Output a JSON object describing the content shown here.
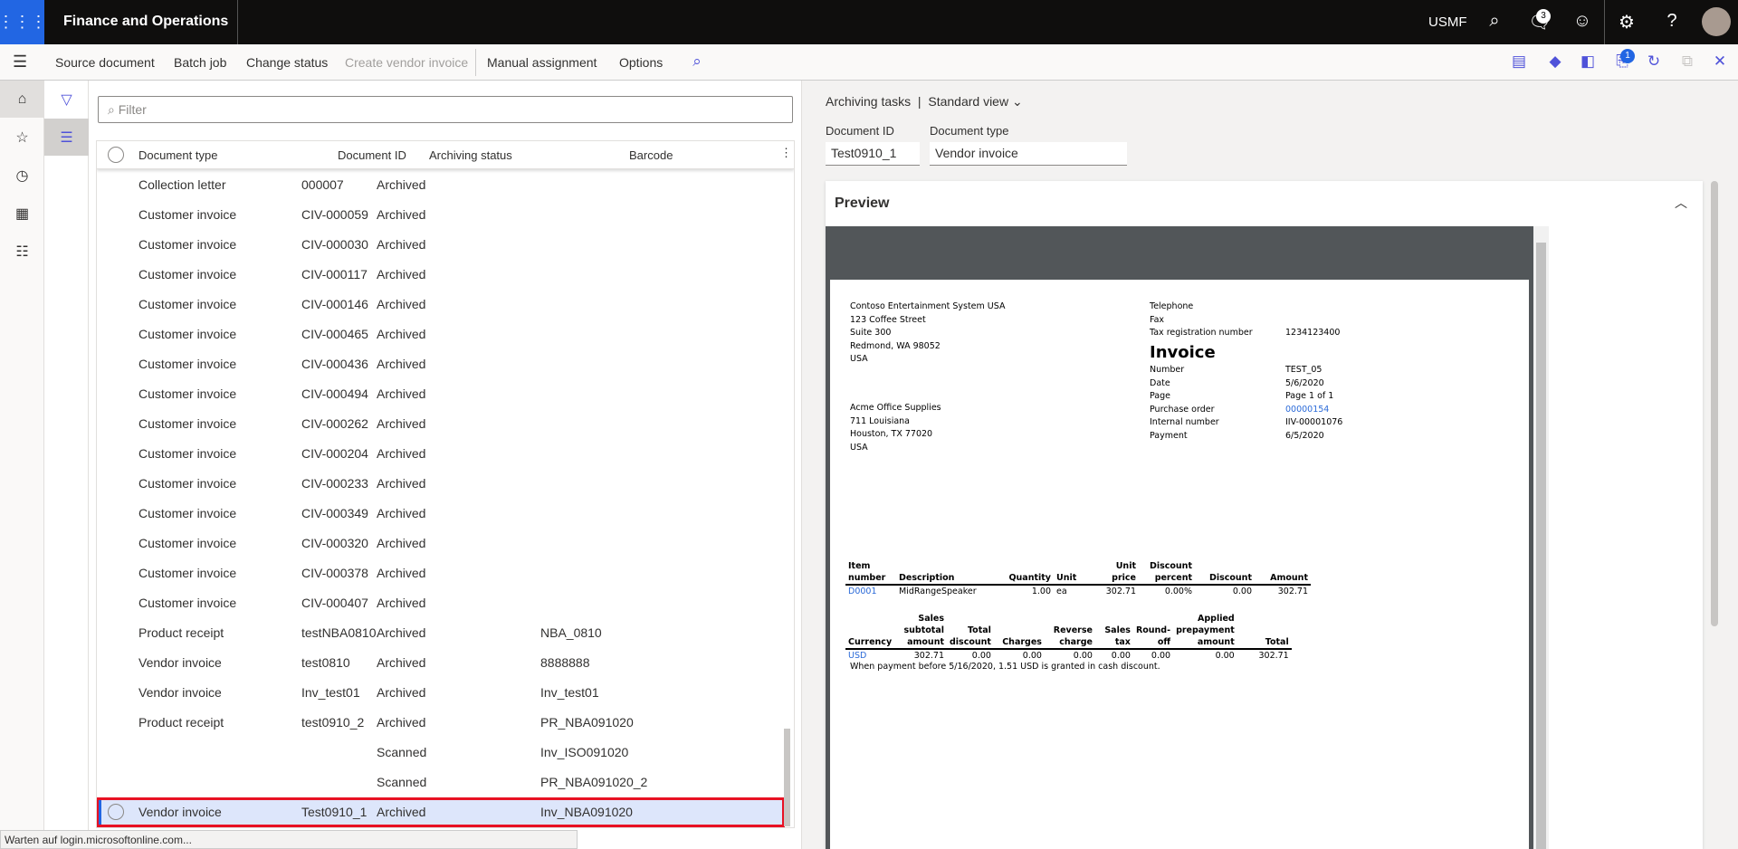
{
  "app": {
    "title": "Finance and Operations",
    "company": "USMF",
    "notifications": "3",
    "status_text": "Warten auf login.microsoftonline.com..."
  },
  "actions": {
    "items": [
      "Source document",
      "Batch job",
      "Change status",
      "Create vendor invoice",
      "Manual assignment",
      "Options"
    ],
    "attachments_count": "1"
  },
  "filter": {
    "placeholder": "Filter"
  },
  "grid": {
    "columns": [
      "Document type",
      "Document ID",
      "Archiving status",
      "Barcode"
    ],
    "rows": [
      [
        "Collection letter",
        "000007",
        "Archived",
        ""
      ],
      [
        "Customer invoice",
        "CIV-000059",
        "Archived",
        ""
      ],
      [
        "Customer invoice",
        "CIV-000030",
        "Archived",
        ""
      ],
      [
        "Customer invoice",
        "CIV-000117",
        "Archived",
        ""
      ],
      [
        "Customer invoice",
        "CIV-000146",
        "Archived",
        ""
      ],
      [
        "Customer invoice",
        "CIV-000465",
        "Archived",
        ""
      ],
      [
        "Customer invoice",
        "CIV-000436",
        "Archived",
        ""
      ],
      [
        "Customer invoice",
        "CIV-000494",
        "Archived",
        ""
      ],
      [
        "Customer invoice",
        "CIV-000262",
        "Archived",
        ""
      ],
      [
        "Customer invoice",
        "CIV-000204",
        "Archived",
        ""
      ],
      [
        "Customer invoice",
        "CIV-000233",
        "Archived",
        ""
      ],
      [
        "Customer invoice",
        "CIV-000349",
        "Archived",
        ""
      ],
      [
        "Customer invoice",
        "CIV-000320",
        "Archived",
        ""
      ],
      [
        "Customer invoice",
        "CIV-000378",
        "Archived",
        ""
      ],
      [
        "Customer invoice",
        "CIV-000407",
        "Archived",
        ""
      ],
      [
        "Product receipt",
        "testNBA0810",
        "Archived",
        "NBA_0810"
      ],
      [
        "Vendor invoice",
        "test0810",
        "Archived",
        "8888888"
      ],
      [
        "Vendor invoice",
        "Inv_test01",
        "Archived",
        "Inv_test01"
      ],
      [
        "Product receipt",
        "test0910_2",
        "Archived",
        "PR_NBA091020"
      ],
      [
        "",
        "",
        "Scanned",
        "Inv_ISO091020"
      ],
      [
        "",
        "",
        "Scanned",
        "PR_NBA091020_2"
      ],
      [
        "Vendor invoice",
        "Test0910_1",
        "Archived",
        "Inv_NBA091020"
      ]
    ],
    "selected_index": 21
  },
  "details": {
    "breadcrumb": "Archiving tasks",
    "view": "Standard view",
    "doc_id_label": "Document ID",
    "doc_id": "Test0910_1",
    "doc_type_label": "Document type",
    "doc_type": "Vendor invoice",
    "preview_label": "Preview"
  },
  "invoice": {
    "from": [
      "Contoso Entertainment System USA",
      "123 Coffee Street",
      "Suite 300",
      "Redmond, WA 98052",
      "USA"
    ],
    "to": [
      "Acme Office Supplies",
      "711 Louisiana",
      "Houston, TX 77020",
      "USA"
    ],
    "contact": [
      [
        "Telephone",
        ""
      ],
      [
        "Fax",
        ""
      ],
      [
        "Tax registration number",
        "1234123400"
      ]
    ],
    "title": "Invoice",
    "meta": [
      [
        "Number",
        "TEST_05"
      ],
      [
        "Date",
        "5/6/2020"
      ],
      [
        "Page",
        "Page 1 of 1"
      ],
      [
        "Purchase order",
        "00000154"
      ],
      [
        "Internal number",
        "IIV-00001076"
      ],
      [
        "Payment",
        "6/5/2020"
      ]
    ],
    "lines_header": [
      "Item number",
      "Description",
      "Quantity",
      "Unit",
      "Unit price",
      "Discount percent",
      "Discount",
      "Amount"
    ],
    "lines": [
      [
        "D0001",
        "MidRangeSpeaker",
        "1.00",
        "ea",
        "302.71",
        "0.00%",
        "0.00",
        "302.71"
      ]
    ],
    "totals_header": [
      "Currency",
      "Sales subtotal amount",
      "Total discount",
      "Charges",
      "Reverse charge",
      "Sales tax",
      "Round-off",
      "Applied prepayment amount",
      "Total"
    ],
    "totals": [
      "USD",
      "302.71",
      "0.00",
      "0.00",
      "0.00",
      "0.00",
      "0.00",
      "0.00",
      "302.71"
    ],
    "note": "When payment before 5/16/2020, 1.51 USD is granted in cash discount."
  },
  "colors": {
    "accent": "#2266e3",
    "selection": "#dde6fb",
    "highlight": "#e81123"
  }
}
